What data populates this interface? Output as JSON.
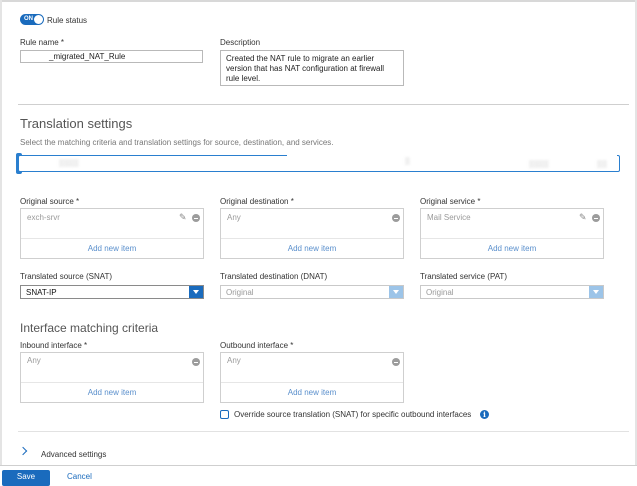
{
  "rule_status": {
    "toggle_text": "ON",
    "label": "Rule status"
  },
  "rule_name": {
    "label": "Rule name *",
    "value": "_migrated_NAT_Rule"
  },
  "description": {
    "label": "Description",
    "value": "Created the NAT rule to migrate an earlier version that has NAT configuration at firewall rule level."
  },
  "translation_settings": {
    "heading": "Translation settings",
    "subtitle": "Select the matching criteria and translation settings for source, destination, and services."
  },
  "original": {
    "source": {
      "label": "Original source *",
      "item": "exch-srvr",
      "add": "Add new item"
    },
    "destination": {
      "label": "Original destination *",
      "item": "Any",
      "add": "Add new item"
    },
    "service": {
      "label": "Original service *",
      "item": "Mail Service",
      "add": "Add new item"
    }
  },
  "translated": {
    "source": {
      "label": "Translated source (SNAT)",
      "value": "SNAT-IP"
    },
    "destination": {
      "label": "Translated destination (DNAT)",
      "value": "Original"
    },
    "service": {
      "label": "Translated service (PAT)",
      "value": "Original"
    }
  },
  "interface_matching": {
    "heading": "Interface matching criteria",
    "inbound": {
      "label": "Inbound interface *",
      "item": "Any",
      "add": "Add new item"
    },
    "outbound": {
      "label": "Outbound interface *",
      "item": "Any",
      "add": "Add new item"
    },
    "override_label": "Override source translation (SNAT) for specific outbound interfaces"
  },
  "advanced_settings": {
    "label": "Advanced settings"
  },
  "footer": {
    "save_label": "Save",
    "cancel_label": "Cancel"
  },
  "colors": {
    "accent": "#1a6bbd",
    "link": "#5a8fcc"
  },
  "icons": [
    "pencil-icon",
    "minus-circle-icon",
    "info-icon",
    "chevron-right-icon",
    "caret-down-icon"
  ]
}
